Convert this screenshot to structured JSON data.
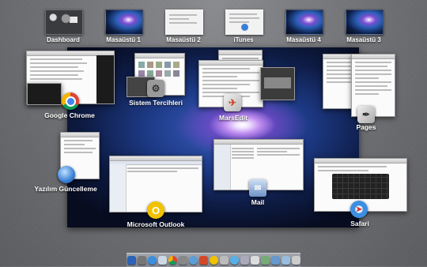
{
  "spaces": [
    {
      "label": "Dashboard",
      "type": "dashboard"
    },
    {
      "label": "Masaüstü 1",
      "type": "galaxy"
    },
    {
      "label": "Masaüstü 2",
      "type": "window"
    },
    {
      "label": "iTunes",
      "type": "window"
    },
    {
      "label": "Masaüstü 4",
      "type": "galaxy"
    },
    {
      "label": "Masaüstü 3",
      "type": "galaxy"
    }
  ],
  "apps": {
    "chrome": "Google Chrome",
    "system_prefs": "Sistem Tercihleri",
    "marsedit": "MarsEdit",
    "pages": "Pages",
    "software_update": "Yazılım Güncelleme",
    "mail": "Mail",
    "outlook": "Microsoft Outlook",
    "safari": "Safari"
  },
  "icons": {
    "chrome": "chrome-icon",
    "system_prefs": "gear-icon",
    "marsedit": "rocket-icon",
    "pages": "pen-icon",
    "software_update": "globe-icon",
    "mail": "stamp-icon",
    "outlook": "outlook-icon",
    "safari": "compass-icon"
  },
  "colors": {
    "background": "#6f7073",
    "label_text": "#ffffff",
    "outlook_accent": "#f2c200",
    "chrome_red": "#db4437",
    "chrome_green": "#0f9d58",
    "chrome_yellow": "#f4b400",
    "safari_blue": "#3b8fe0"
  }
}
